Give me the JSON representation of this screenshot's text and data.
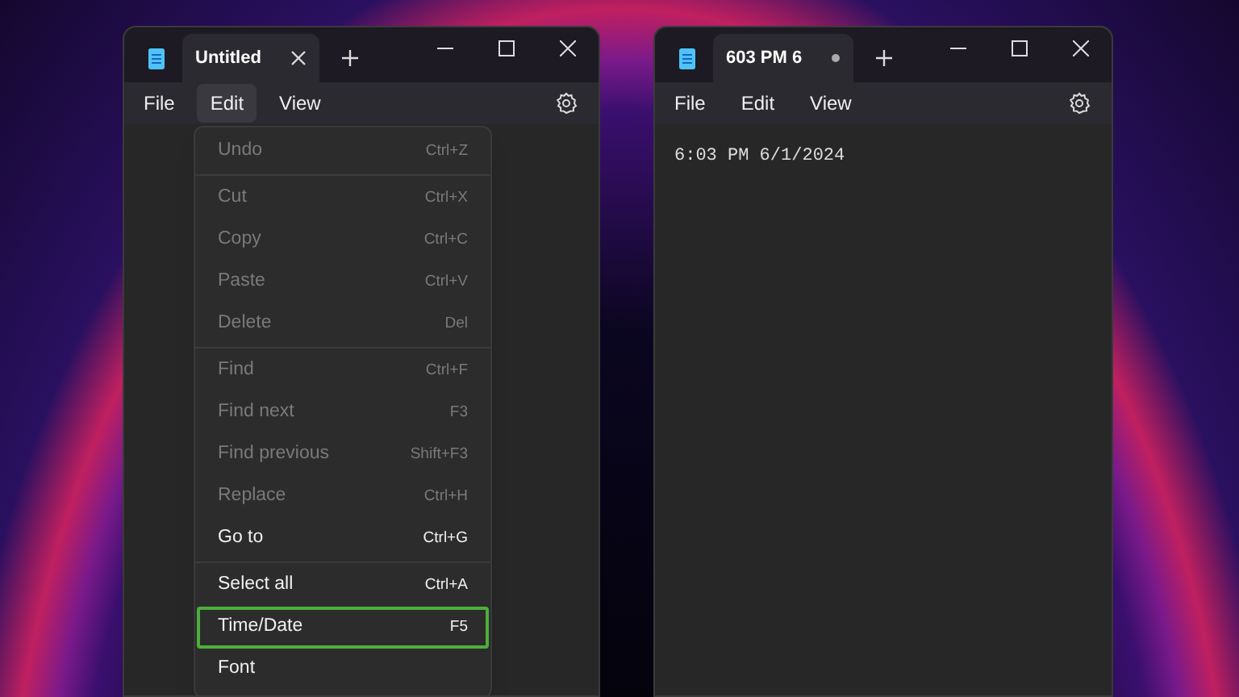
{
  "windows": [
    {
      "tabs": [
        {
          "title": "Untitled",
          "selected": true,
          "modified": false
        }
      ],
      "menus": [
        {
          "label": "File",
          "selected": false
        },
        {
          "label": "Edit",
          "selected": true
        },
        {
          "label": "View",
          "selected": false
        }
      ],
      "dropdown": {
        "groups": [
          [
            {
              "label": "Undo",
              "shortcut": "Ctrl+Z",
              "disabled": true,
              "highlighted": false
            }
          ],
          [
            {
              "label": "Cut",
              "shortcut": "Ctrl+X",
              "disabled": true,
              "highlighted": false
            },
            {
              "label": "Copy",
              "shortcut": "Ctrl+C",
              "disabled": true,
              "highlighted": false
            },
            {
              "label": "Paste",
              "shortcut": "Ctrl+V",
              "disabled": true,
              "highlighted": false
            },
            {
              "label": "Delete",
              "shortcut": "Del",
              "disabled": true,
              "highlighted": false
            }
          ],
          [
            {
              "label": "Find",
              "shortcut": "Ctrl+F",
              "disabled": true,
              "highlighted": false
            },
            {
              "label": "Find next",
              "shortcut": "F3",
              "disabled": true,
              "highlighted": false
            },
            {
              "label": "Find previous",
              "shortcut": "Shift+F3",
              "disabled": true,
              "highlighted": false
            },
            {
              "label": "Replace",
              "shortcut": "Ctrl+H",
              "disabled": true,
              "highlighted": false
            },
            {
              "label": "Go to",
              "shortcut": "Ctrl+G",
              "disabled": false,
              "highlighted": false
            }
          ],
          [
            {
              "label": "Select all",
              "shortcut": "Ctrl+A",
              "disabled": false,
              "highlighted": false
            },
            {
              "label": "Time/Date",
              "shortcut": "F5",
              "disabled": false,
              "highlighted": true
            },
            {
              "label": "Font",
              "disabled": false,
              "highlighted": false
            }
          ]
        ]
      }
    },
    {
      "tabs": [
        {
          "title": "603 PM 6",
          "selected": true,
          "modified": true
        }
      ],
      "menus": [
        {
          "label": "File",
          "selected": false
        },
        {
          "label": "Edit",
          "selected": false
        },
        {
          "label": "View",
          "selected": false
        }
      ],
      "text": "6:03 PM 6/1/2024"
    }
  ]
}
